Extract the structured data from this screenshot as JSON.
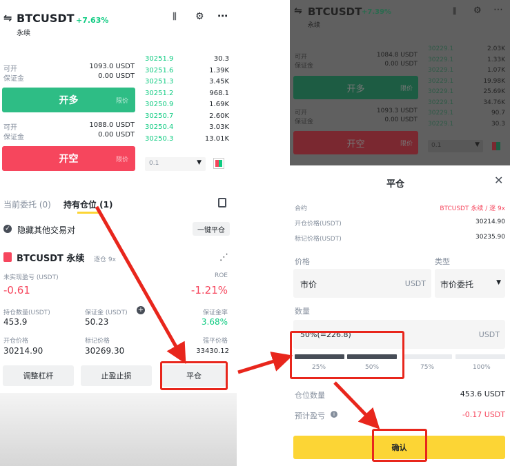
{
  "left": {
    "pair": "BTCUSDT",
    "change": "+7.63%",
    "subtitle": "永续",
    "long": {
      "avail_label": "可开",
      "avail_value": "1093.0 USDT",
      "margin_label": "保证金",
      "margin_value": "0.00 USDT",
      "button": "开多",
      "button_sub": "限价"
    },
    "short": {
      "avail_label": "可开",
      "avail_value": "1088.0 USDT",
      "margin_label": "保证金",
      "margin_value": "0.00 USDT",
      "button": "开空",
      "button_sub": "限价"
    },
    "orderbook": [
      {
        "price": "30251.9",
        "qty": "30.3"
      },
      {
        "price": "30251.6",
        "qty": "1.39K"
      },
      {
        "price": "30251.3",
        "qty": "3.45K"
      },
      {
        "price": "30251.2",
        "qty": "968.1"
      },
      {
        "price": "30250.9",
        "qty": "1.69K"
      },
      {
        "price": "30250.7",
        "qty": "2.60K"
      },
      {
        "price": "30250.4",
        "qty": "3.03K"
      },
      {
        "price": "30250.3",
        "qty": "13.01K"
      }
    ],
    "depth_select": "0.1",
    "tabs": {
      "current": "当前委托 (0)",
      "positions": "持有仓位 (1)"
    },
    "hide_others": "隐藏其他交易对",
    "close_all": "一键平仓",
    "position": {
      "symbol": "BTCUSDT 永续",
      "mode": "逐仓 9x",
      "pnl_label": "未实现盈亏 (USDT)",
      "pnl": "-0.61",
      "roe_label": "ROE",
      "roe": "-1.21%",
      "size_label": "持仓数量(USDT)",
      "size": "453.9",
      "margin_label": "保证金 (USDT)",
      "margin": "50.23",
      "ratio_label": "保证金率",
      "ratio": "3.68%",
      "entry_label": "开仓价格",
      "entry": "30214.90",
      "mark_label": "标记价格",
      "mark": "30269.30",
      "liq_label": "强平价格",
      "liq": "33430.12"
    },
    "actions": {
      "leverage": "调整杠杆",
      "tpsl": "止盈止损",
      "close": "平仓"
    }
  },
  "right_top": {
    "pair": "BTCUSDT",
    "change": "+7.39%",
    "subtitle": "永续",
    "avail_label": "可开",
    "avail_value": "1084.8 USDT",
    "margin_label": "保证金",
    "margin_value": "0.00 USDT",
    "long_button": "开多",
    "long_sub": "限价",
    "avail2_value": "1093.3 USDT",
    "margin2_value": "0.00 USDT",
    "short_button": "开空",
    "short_sub": "限价",
    "orderbook": [
      {
        "price": "30229.1",
        "qty": "2.03K"
      },
      {
        "price": "30229.1",
        "qty": "1.33K"
      },
      {
        "price": "30229.1",
        "qty": "1.07K"
      },
      {
        "price": "30229.1",
        "qty": "19.98K"
      },
      {
        "price": "30229.1",
        "qty": "25.69K"
      },
      {
        "price": "30229.1",
        "qty": "34.76K"
      },
      {
        "price": "30229.1",
        "qty": "90.7"
      },
      {
        "price": "30229.1",
        "qty": "30.3"
      }
    ],
    "depth_select": "0.1"
  },
  "sheet": {
    "title": "平仓",
    "contract_label": "合约",
    "contract_value": "BTCUSDT 永续 / 逐 9x",
    "entry_label": "开仓价格(USDT)",
    "entry_value": "30214.90",
    "mark_label": "标记价格(USDT)",
    "mark_value": "30235.90",
    "price_label": "价格",
    "price_value": "市价",
    "price_unit": "USDT",
    "type_label": "类型",
    "type_value": "市价委托",
    "qty_label": "数量",
    "qty_value": "50%(=226.8)",
    "qty_unit": "USDT",
    "slider": {
      "marks": [
        "25%",
        "50%",
        "75%",
        "100%"
      ],
      "level": 0.5
    },
    "pos_label": "仓位数量",
    "pos_value": "453.6 USDT",
    "est_label": "预计盈亏",
    "est_value": "-0.17 USDT",
    "confirm": "确认"
  },
  "colors": {
    "green": "#2ebd85",
    "red": "#f6465d",
    "yellow": "#fcd535",
    "highlight": "#e8261c"
  }
}
